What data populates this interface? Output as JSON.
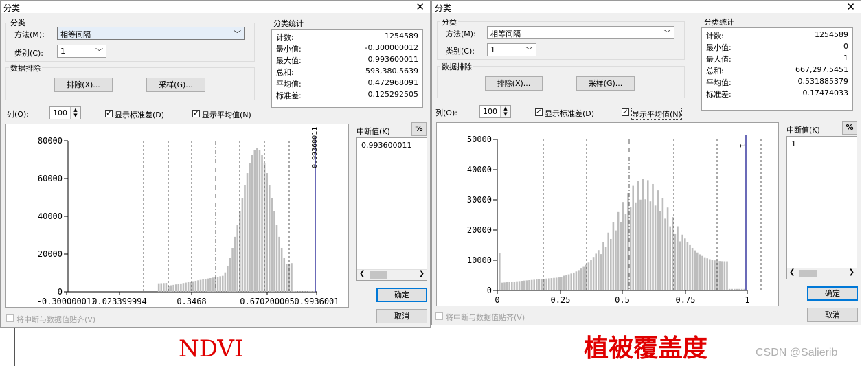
{
  "dialogs": [
    {
      "title": "分类",
      "classification_group": "分类",
      "method_label": "方法(M):",
      "method_value": "相等间隔",
      "classes_label": "类别(C):",
      "classes_value": "1",
      "exclusion_group": "数据排除",
      "exclude_button": "排除(X)...",
      "sample_button": "采样(G)...",
      "stats_group": "分类统计",
      "stats": [
        {
          "label": "计数:",
          "value": "1254589"
        },
        {
          "label": "最小值:",
          "value": "-0.300000012"
        },
        {
          "label": "最大值:",
          "value": "0.993600011"
        },
        {
          "label": "总和:",
          "value": "593,380.5639"
        },
        {
          "label": "平均值:",
          "value": "0.472968091"
        },
        {
          "label": "标准差:",
          "value": "0.125292505"
        }
      ],
      "columns_label": "列(O):",
      "columns_value": "100",
      "show_std_label": "显示标准差(D)",
      "show_mean_label": "显示平均值(N)",
      "breaks_label": "中断值(K)",
      "percent_button": "%",
      "breaks": [
        "0.993600011"
      ],
      "ok_button": "确定",
      "cancel_button": "取消",
      "snap_label": "将中断与数据值贴齐(V)",
      "histogram": {
        "y_ticks": [
          "80000",
          "60000",
          "40000",
          "20000",
          "0"
        ],
        "x_ticks": [
          "-0.300000012",
          "0.023399994",
          "0.3468",
          "0.670200005",
          "0.9936001"
        ],
        "break_label": "0.99360011"
      }
    },
    {
      "title": "分类",
      "classification_group": "分类",
      "method_label": "方法(M):",
      "method_value": "相等间隔",
      "classes_label": "类别(C):",
      "classes_value": "1",
      "exclusion_group": "数据排除",
      "exclude_button": "排除(X)...",
      "sample_button": "采样(G)...",
      "stats_group": "分类统计",
      "stats": [
        {
          "label": "计数:",
          "value": "1254589"
        },
        {
          "label": "最小值:",
          "value": "0"
        },
        {
          "label": "最大值:",
          "value": "1"
        },
        {
          "label": "总和:",
          "value": "667,297.5451"
        },
        {
          "label": "平均值:",
          "value": "0.531885379"
        },
        {
          "label": "标准差:",
          "value": "0.17474033"
        }
      ],
      "columns_label": "列(O):",
      "columns_value": "100",
      "show_std_label": "显示标准差(D)",
      "show_mean_label": "显示平均值(N)",
      "breaks_label": "中断值(K)",
      "percent_button": "%",
      "breaks": [
        "1"
      ],
      "ok_button": "确定",
      "cancel_button": "取消",
      "snap_label": "将中断与数据值贴齐(V)",
      "histogram": {
        "y_ticks": [
          "50000",
          "40000",
          "30000",
          "20000",
          "10000",
          "0"
        ],
        "x_ticks": [
          "0",
          "0.25",
          "0.5",
          "0.75",
          "1"
        ],
        "break_label": "1"
      }
    }
  ],
  "captions": {
    "left": "NDVI",
    "right": "植被覆盖度"
  },
  "watermark": "CSDN @Salierib"
}
